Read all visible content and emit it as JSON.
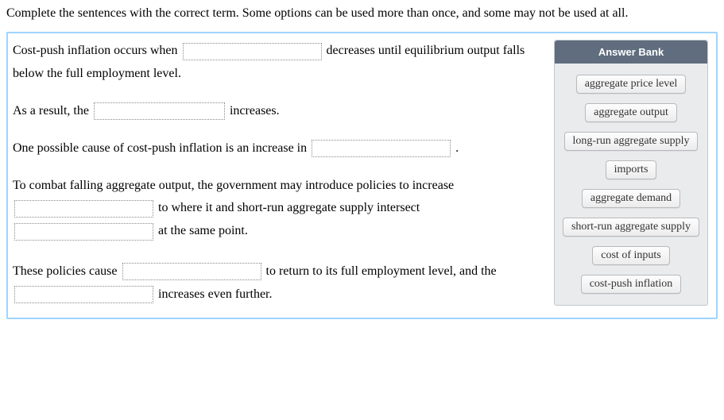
{
  "instruction": "Complete the sentences with the correct term. Some options can be used more than once, and some may not be used at all.",
  "sentences": {
    "s1a": "Cost-push inflation occurs when ",
    "s1b": " decreases until equilibrium output falls below the full employment level.",
    "s2a": "As a result, the ",
    "s2b": " increases.",
    "s3a": "One possible cause of cost-push inflation is an increase in ",
    "s3b": " .",
    "s4a": "To combat falling aggregate output, the government may introduce policies to increase ",
    "s4b": " to where it and short-run aggregate supply intersect ",
    "s4c": " at the same point.",
    "s5a": "These policies cause ",
    "s5b": " to return to its full employment level, and the ",
    "s5c": " increases even further."
  },
  "answerBank": {
    "title": "Answer Bank",
    "items": [
      "aggregate price level",
      "aggregate output",
      "long-run aggregate supply",
      "imports",
      "aggregate demand",
      "short-run aggregate supply",
      "cost of inputs",
      "cost-push inflation"
    ]
  }
}
